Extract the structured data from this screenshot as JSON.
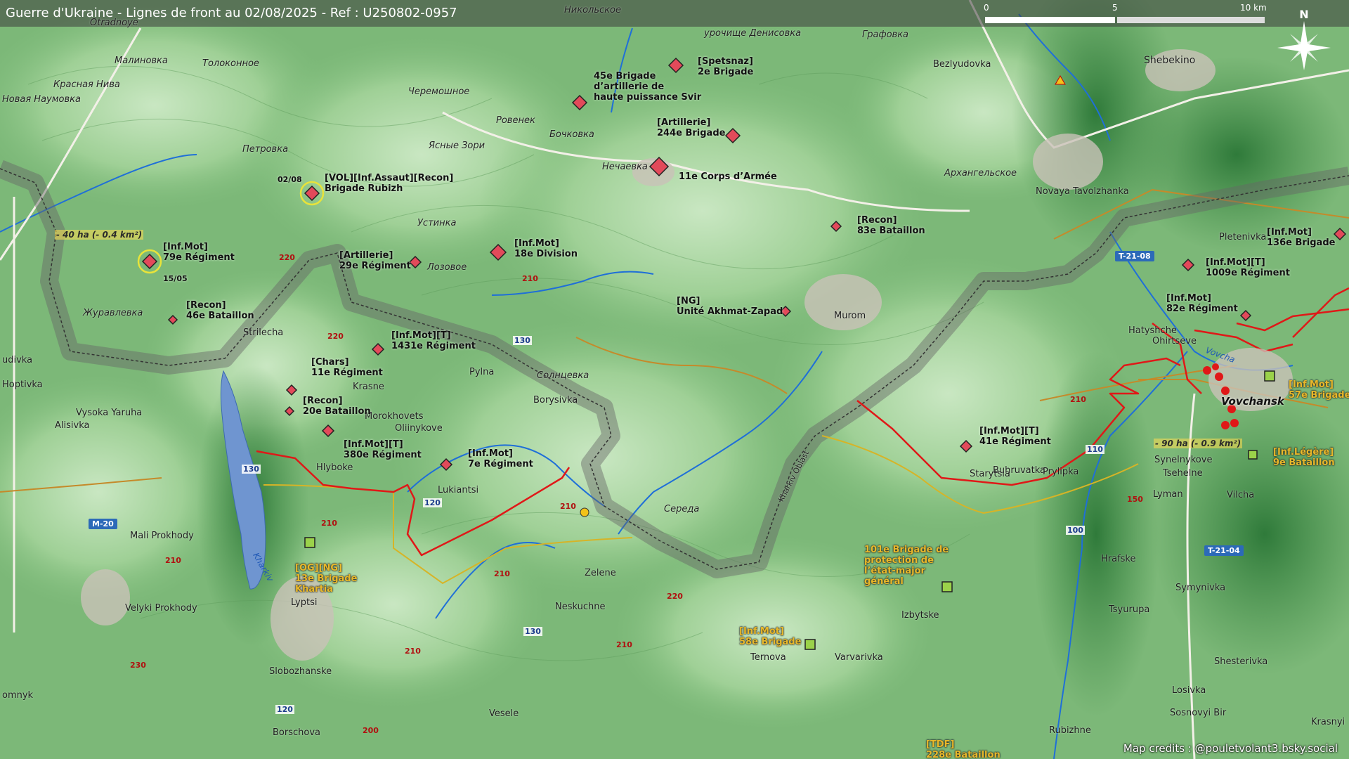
{
  "header": {
    "title": "Guerre d'Ukraine - Lignes de front au 02/08/2025 - Ref : U250802-0957",
    "scale": {
      "tick0": "0",
      "tick1": "5",
      "tick2": "10 km"
    },
    "north": "N"
  },
  "credits": "Map credits : @pouletvolant3.bsky.social",
  "colors": {
    "russian_unit": "#e24a5a",
    "ukrainian_unit": "#9bd24a",
    "front_line": "#e01818",
    "border": "#666666",
    "ua_label": "#e8b82a"
  },
  "places": [
    "Никольское",
    "Otradnoye",
    "Малиновка",
    "Толоконное",
    "урочище Денисовка",
    "Графовка",
    "Bezlyudovka",
    "Shebekino",
    "Красная Нива",
    "Новая Наумовка",
    "Черемошное",
    "Ровенек",
    "Бочковка",
    "Ясные Зори",
    "Нечаевка",
    "Петровка",
    "Архангельское",
    "Novaya Tavolzhanka",
    "Устинка",
    "Лозовое",
    "Журавлевка",
    "Strilecha",
    "Солнцевка",
    "Borysivka",
    "Pylna",
    "Krasne",
    "Morokhovets",
    "Oliinykove",
    "Hoptivka",
    "Vysoka Yaruha",
    "Alisivka",
    "Hlyboke",
    "Lukiantsi",
    "Середа",
    "Murom",
    "Hatyshche",
    "Ohirtseve",
    "Vovchansk",
    "Pletenivka",
    "Buhruvatka",
    "Prylipka",
    "Starytsia",
    "Synelnykove",
    "Tsehelne",
    "Lyman",
    "Vilcha",
    "Mali Prokhody",
    "Velyki Prokhody",
    "Lyptsi",
    "Zelene",
    "Neskuchne",
    "Izbytske",
    "Varvarivka",
    "Ternova",
    "Slobozhanske",
    "Borschova",
    "Vesele",
    "Rubizhne",
    "Hrafske",
    "Symynivka",
    "Tsyurupa",
    "Shesterivka",
    "Losivka",
    "Sosnovyi Bir",
    "Kharkiv Oblast",
    "Vovcha",
    "Kharkiv",
    "udivka",
    "omnyk",
    "Krasnyi"
  ],
  "units_ru": [
    "[Spetsnaz]\n2e Brigade",
    "45e Brigade\nd’artillerie de\nhaute puissance Svir",
    "[Artillerie]\n244e Brigade",
    "11e Corps d’Armée",
    "[VOL][Inf.Assaut][Recon]\nBrigade Rubizh",
    "[Inf.Mot]\n79e Régiment",
    "[Artillerie]\n29e Régiment",
    "[Inf.Mot]\n18e Division",
    "[Recon]\n83e Bataillon",
    "[NG]\nUnité Akhmat-Zapad",
    "[Recon]\n46e Bataillon",
    "[Inf.Mot][T]\n1431e Régiment",
    "[Chars]\n11e Régiment",
    "[Recon]\n20e Bataillon",
    "[Inf.Mot][T]\n380e Régiment",
    "[Inf.Mot]\n7e Régiment",
    "[Inf.Mot][T]\n41e Régiment",
    "[Inf.Mot]\n136e Brigade",
    "[Inf.Mot][T]\n1009e Régiment",
    "[Inf.Mot]\n82e Régiment"
  ],
  "units_ua": [
    "[Inf.Mot]\n57e Brigade",
    "[Inf.Légère]\n9e Bataillon",
    "[OG][NG]\n13e Brigade\nKhartia",
    "101e Brigade de\nprotection de\nl’état-major\ngénéral",
    "[Inf.Mot]\n58e Brigade",
    "[TDF]\n228e Bataillon"
  ],
  "dates": {
    "d1": "02/08",
    "d2": "15/05"
  },
  "areas": {
    "west": "- 40 ha (- 0.4 km²)",
    "east": "- 90 ha (- 0.9 km²)"
  },
  "roads": {
    "m20": "M-20",
    "t2108": "T-21-08",
    "t2104": "T-21-04",
    "r130": "130",
    "r120": "120",
    "r110": "110",
    "r100": "100"
  },
  "elevations": {
    "e200": "200",
    "e210": "210",
    "e220": "220",
    "e230": "230",
    "e150": "150"
  }
}
